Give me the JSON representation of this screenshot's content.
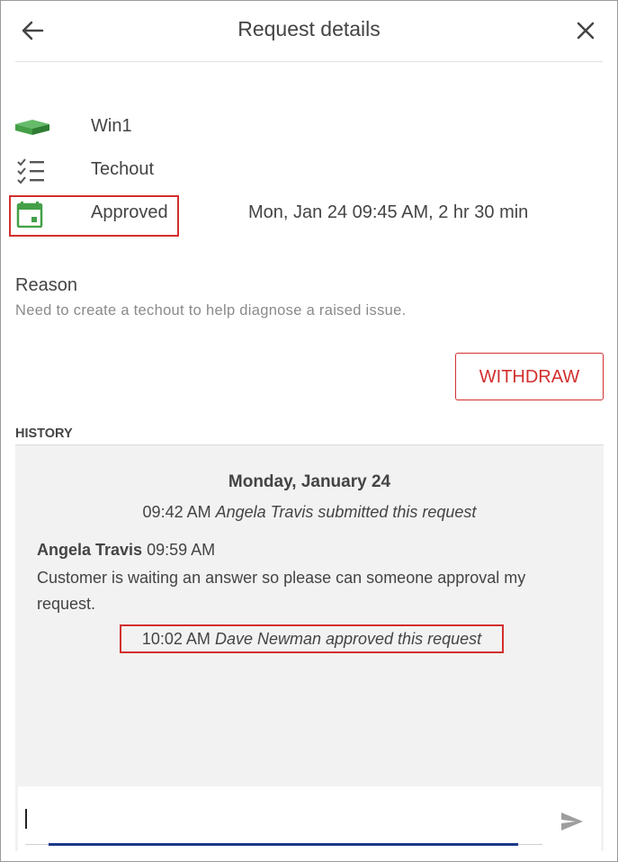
{
  "header": {
    "title": "Request details",
    "back_icon": "arrow-left-icon",
    "close_icon": "close-icon"
  },
  "details": {
    "device": {
      "icon": "device-icon",
      "label": "Win1"
    },
    "type": {
      "icon": "checklist-icon",
      "label": "Techout"
    },
    "status": {
      "icon": "calendar-icon",
      "label": "Approved",
      "schedule": "Mon, Jan 24 09:45 AM, 2 hr 30 min"
    }
  },
  "reason": {
    "title": "Reason",
    "text": "Need to create a techout to help diagnose a raised issue."
  },
  "actions": {
    "withdraw_label": "WITHDRAW"
  },
  "history": {
    "label": "HISTORY",
    "date": "Monday, January 24",
    "submitted": {
      "time": "09:42 AM",
      "text": "Angela Travis submitted this request"
    },
    "message": {
      "author": "Angela Travis",
      "time": "09:59 AM",
      "body": "Customer is waiting an answer so please can someone approval my request."
    },
    "approved": {
      "time": "10:02 AM",
      "text": "Dave Newman approved this request"
    }
  },
  "composer": {
    "value": "",
    "send_icon": "send-icon"
  },
  "colors": {
    "accent_red": "#d32f2f",
    "icon_green": "#4caf50",
    "focus_blue": "#1a3a8a"
  }
}
